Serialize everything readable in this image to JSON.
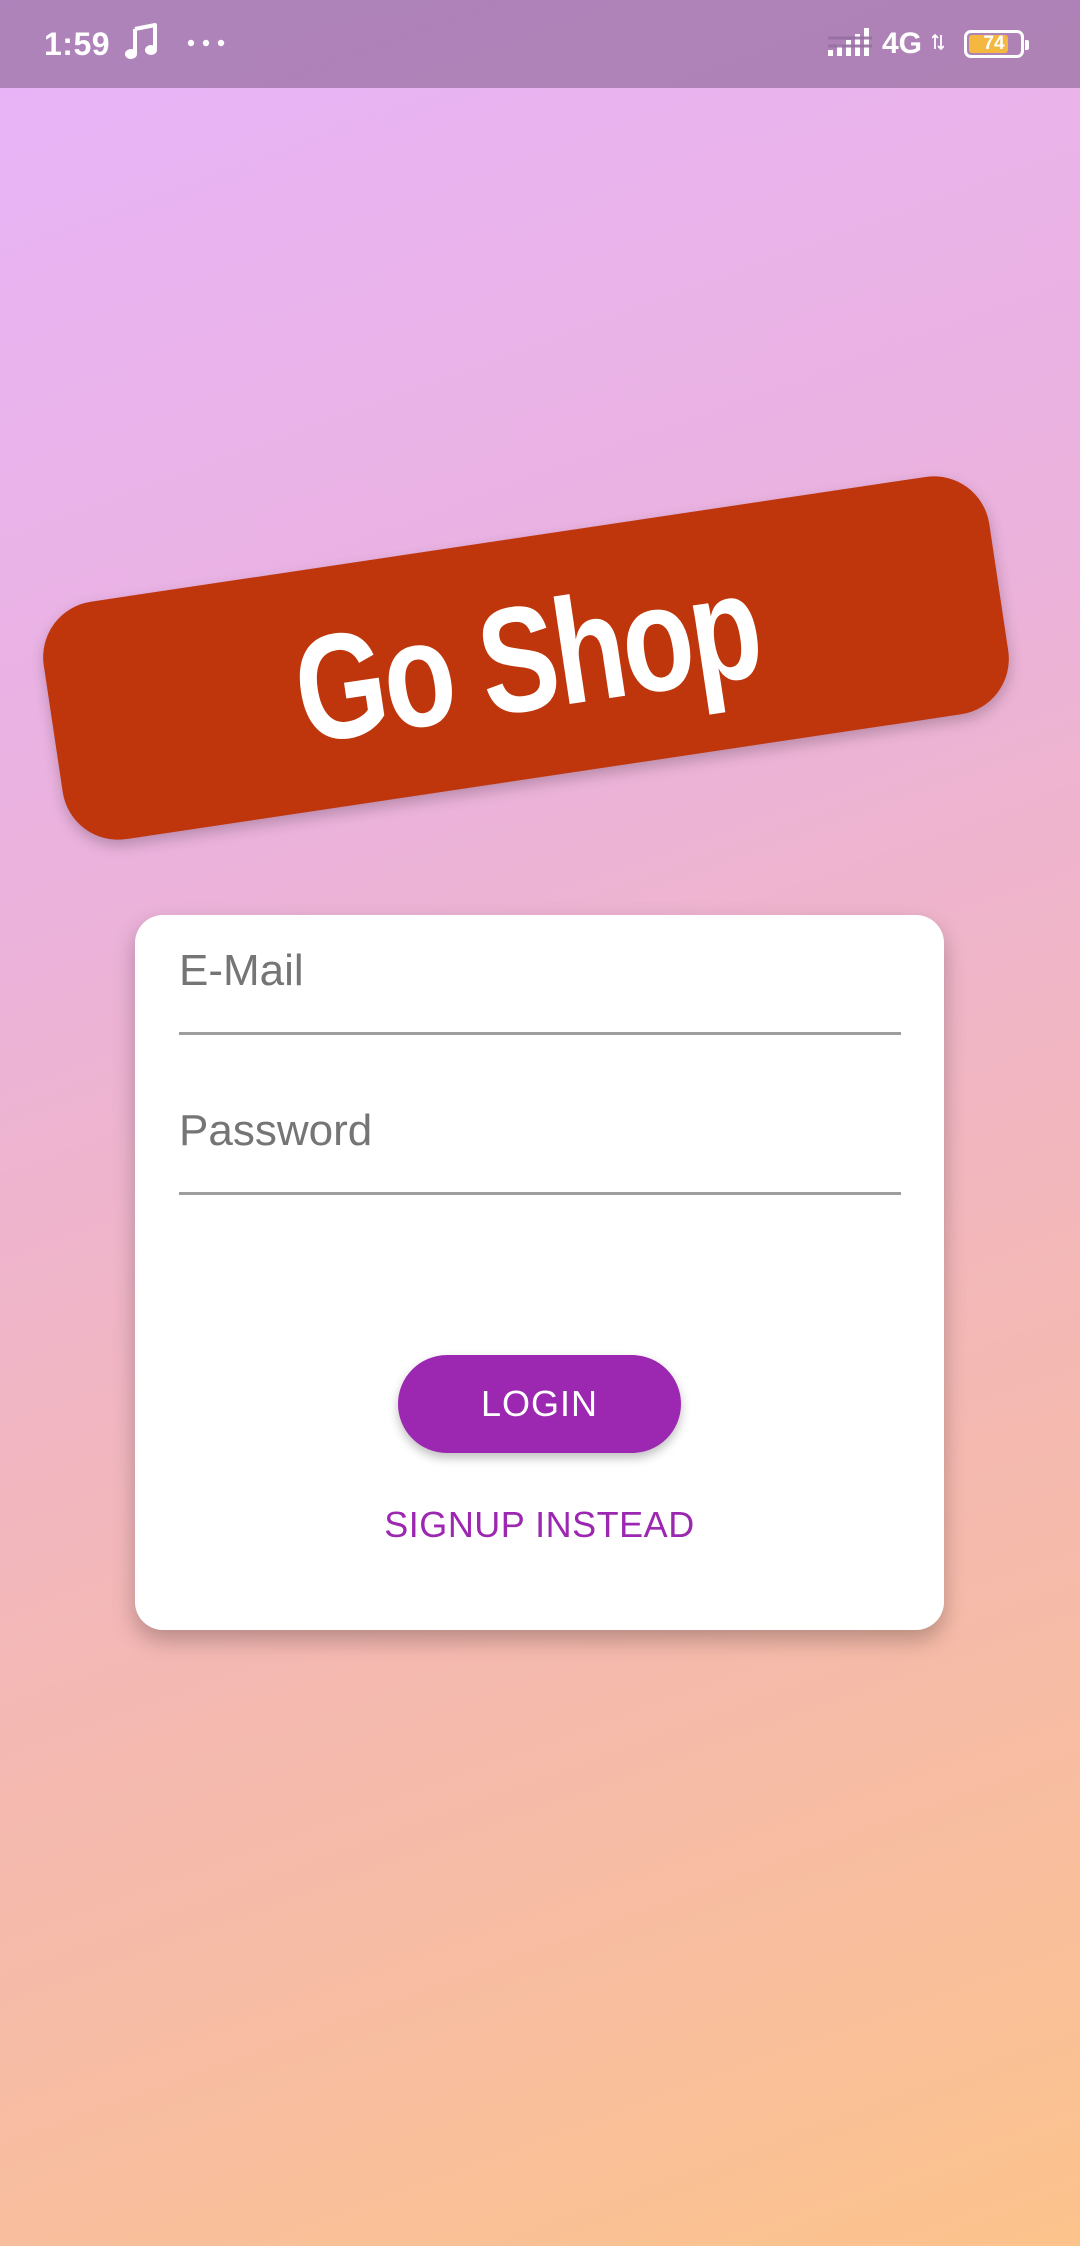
{
  "status_bar": {
    "time": "1:59",
    "music_icon": "music-note-icon",
    "more_icon": "more-dots-icon",
    "signal_icon": "signal-bars-icon",
    "network": "4G",
    "battery_level": "74"
  },
  "banner": {
    "title": "Go Shop",
    "color": "#bf360c"
  },
  "form": {
    "email_placeholder": "E-Mail",
    "email_value": "",
    "password_placeholder": "Password",
    "password_value": "",
    "login_label": "LOGIN",
    "signup_label": "SIGNUP INSTEAD"
  },
  "colors": {
    "accent": "#9c27b0",
    "background_top": "#e8b4fa",
    "background_bottom": "#fcc38c"
  }
}
